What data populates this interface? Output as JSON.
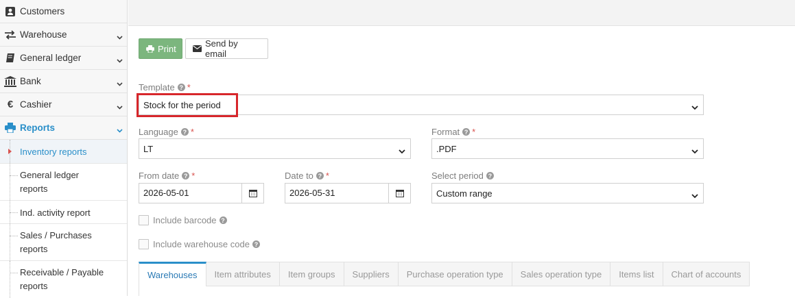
{
  "sidebar": {
    "items": [
      {
        "label": "Customers",
        "icon": "user-card-icon",
        "chevron": false,
        "active": false
      },
      {
        "label": "Warehouse",
        "icon": "transfer-arrows-icon",
        "chevron": true,
        "active": false
      },
      {
        "label": "General ledger",
        "icon": "book-icon",
        "chevron": true,
        "active": false
      },
      {
        "label": "Bank",
        "icon": "bank-icon",
        "chevron": true,
        "active": false
      },
      {
        "label": "Cashier",
        "icon": "euro-icon",
        "chevron": true,
        "active": false
      },
      {
        "label": "Reports",
        "icon": "printer-icon",
        "chevron": true,
        "active": true
      }
    ],
    "subitems": [
      {
        "label": "Inventory reports",
        "current": true
      },
      {
        "label": "General ledger reports",
        "current": false
      },
      {
        "label": "Ind. activity report",
        "current": false
      },
      {
        "label": "Sales / Purchases reports",
        "current": false
      },
      {
        "label": "Receivable / Payable reports",
        "current": false
      }
    ]
  },
  "toolbar": {
    "print_label": "Print",
    "email_label": "Send by email"
  },
  "form": {
    "template": {
      "label": "Template",
      "value": "Stock for the period"
    },
    "language": {
      "label": "Language",
      "value": "LT"
    },
    "format": {
      "label": "Format",
      "value": ".PDF"
    },
    "from_date": {
      "label": "From date",
      "value": "2026-05-01"
    },
    "date_to": {
      "label": "Date to",
      "value": "2026-05-31"
    },
    "select_period": {
      "label": "Select period",
      "value": "Custom range"
    },
    "include_barcode": {
      "label": "Include barcode",
      "checked": false
    },
    "include_warehouse_code": {
      "label": "Include warehouse code",
      "checked": false
    }
  },
  "tabs": [
    {
      "label": "Warehouses",
      "active": true
    },
    {
      "label": "Item attributes",
      "active": false
    },
    {
      "label": "Item groups",
      "active": false
    },
    {
      "label": "Suppliers",
      "active": false
    },
    {
      "label": "Purchase operation type",
      "active": false
    },
    {
      "label": "Sales operation type",
      "active": false
    },
    {
      "label": "Items list",
      "active": false
    },
    {
      "label": "Chart of accounts",
      "active": false
    }
  ],
  "colors": {
    "accent": "#2a8fc9",
    "print_button": "#7cb67e",
    "required": "#d9534f",
    "highlight_box": "#d7262b"
  }
}
